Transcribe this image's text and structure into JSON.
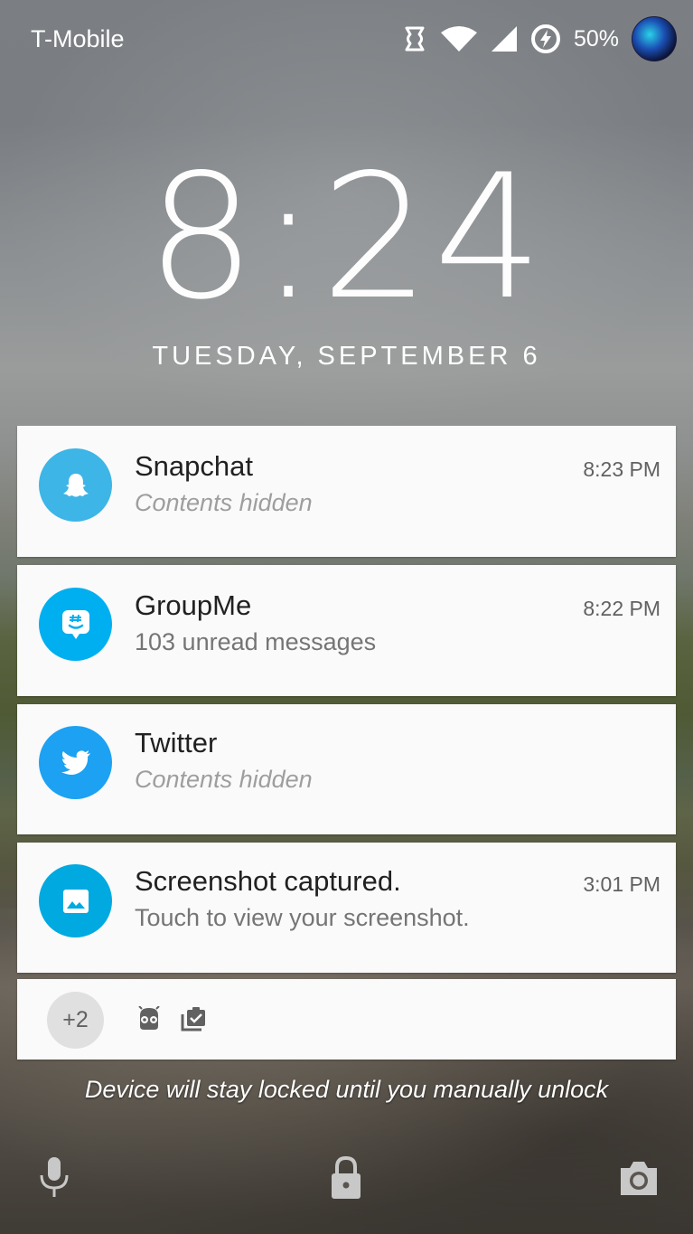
{
  "status_bar": {
    "carrier": "T-Mobile",
    "battery_percent": "50%",
    "icons": [
      "nfc-icon",
      "wifi-icon",
      "cell-signal-icon",
      "battery-saver-icon",
      "avatar"
    ]
  },
  "lockscreen": {
    "time": "8:24",
    "date": "TUESDAY, SEPTEMBER 6",
    "lock_message": "Device will stay locked until you manually unlock"
  },
  "notifications": [
    {
      "app": "Snapchat",
      "text": "Contents hidden",
      "time": "8:23 PM",
      "icon": "snapchat-ghost-icon",
      "color": "#3db5e6"
    },
    {
      "app": "GroupMe",
      "text": "103 unread messages",
      "time": "8:22 PM",
      "icon": "groupme-icon",
      "color": "#00aff0"
    },
    {
      "app": "Twitter",
      "text": "Contents hidden",
      "time": "",
      "icon": "twitter-bird-icon",
      "color": "#1da1f2"
    },
    {
      "app": "Screenshot captured.",
      "text": "Touch to view your screenshot.",
      "time": "3:01 PM",
      "icon": "image-icon",
      "color": "#00a9e0"
    }
  ],
  "overflow": {
    "count": "+2",
    "icons": [
      "android-icon",
      "clipboard-check-icon"
    ]
  },
  "bottom_bar": {
    "icons": [
      "microphone-icon",
      "lock-icon",
      "camera-icon"
    ]
  }
}
